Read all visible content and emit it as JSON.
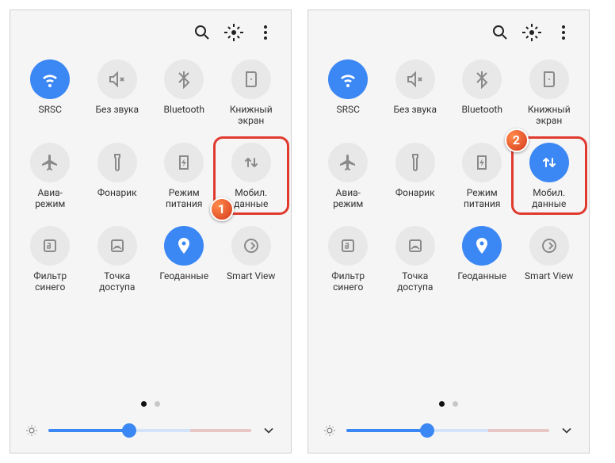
{
  "panels": [
    {
      "tiles": [
        {
          "id": "wifi",
          "label": "SRSC",
          "icon": "wifi",
          "active": true
        },
        {
          "id": "mute",
          "label": "Без звука",
          "icon": "mute",
          "active": false
        },
        {
          "id": "bt",
          "label": "Bluetooth",
          "icon": "bluetooth",
          "active": false
        },
        {
          "id": "book",
          "label": "Книжный\nэкран",
          "icon": "book",
          "active": false
        },
        {
          "id": "airplane",
          "label": "Авиа-\nрежим",
          "icon": "airplane",
          "active": false
        },
        {
          "id": "flash",
          "label": "Фонарик",
          "icon": "flashlight",
          "active": false
        },
        {
          "id": "power",
          "label": "Режим\nпитания",
          "icon": "battery",
          "active": false
        },
        {
          "id": "mobile",
          "label": "Мобил.\nданные",
          "icon": "data",
          "active": false,
          "highlight": true,
          "badge": "1"
        },
        {
          "id": "bluefilter",
          "label": "Фильтр\nсинего",
          "icon": "bfilter",
          "active": false
        },
        {
          "id": "hotspot",
          "label": "Точка\nдоступа",
          "icon": "hotspot",
          "active": false
        },
        {
          "id": "geo",
          "label": "Геоданные",
          "icon": "location",
          "active": true
        },
        {
          "id": "smartview",
          "label": "Smart View",
          "icon": "smartview",
          "active": false
        }
      ],
      "pages": {
        "current": 0,
        "total": 2
      },
      "brightness": 40
    },
    {
      "tiles": [
        {
          "id": "wifi",
          "label": "SRSC",
          "icon": "wifi",
          "active": true
        },
        {
          "id": "mute",
          "label": "Без звука",
          "icon": "mute",
          "active": false
        },
        {
          "id": "bt",
          "label": "Bluetooth",
          "icon": "bluetooth",
          "active": false
        },
        {
          "id": "book",
          "label": "Книжный\nэкран",
          "icon": "book",
          "active": false
        },
        {
          "id": "airplane",
          "label": "Авиа-\nрежим",
          "icon": "airplane",
          "active": false
        },
        {
          "id": "flash",
          "label": "Фонарик",
          "icon": "flashlight",
          "active": false
        },
        {
          "id": "power",
          "label": "Режим\nпитания",
          "icon": "battery",
          "active": false
        },
        {
          "id": "mobile",
          "label": "Мобил.\nданные",
          "icon": "data",
          "active": true,
          "highlight": true,
          "badge": "2"
        },
        {
          "id": "bluefilter",
          "label": "Фильтр\nсинего",
          "icon": "bfilter",
          "active": false
        },
        {
          "id": "hotspot",
          "label": "Точка\nдоступа",
          "icon": "hotspot",
          "active": false
        },
        {
          "id": "geo",
          "label": "Геоданные",
          "icon": "location",
          "active": true
        },
        {
          "id": "smartview",
          "label": "Smart View",
          "icon": "smartview",
          "active": false
        }
      ],
      "pages": {
        "current": 0,
        "total": 2
      },
      "brightness": 40
    }
  ]
}
